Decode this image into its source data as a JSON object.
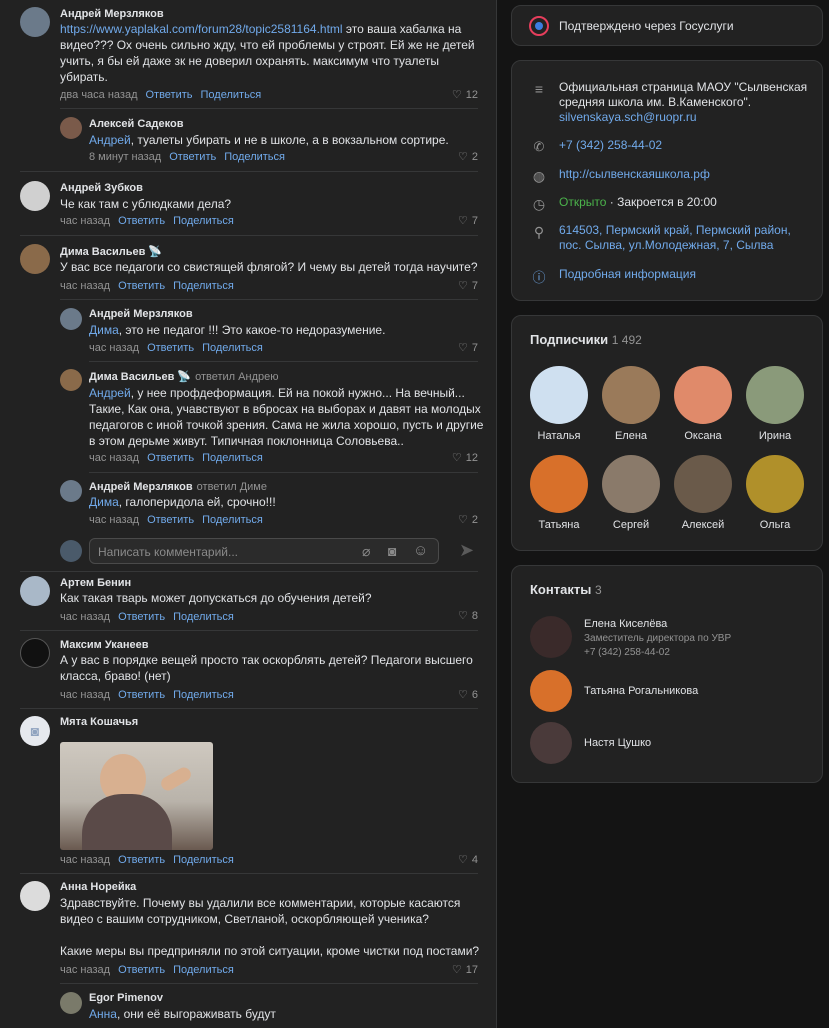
{
  "comments": [
    {
      "author": "Андрей Мерзляков",
      "link": "https://www.yaplakal.com/forum28/topic2581164.html",
      "text_after_link": " это ваша хабалка на видео??? Ох очень сильно жду, что ей проблемы у строят. Ей же не детей учить, я бы ей даже зк не доверил охранять. максимум что туалеты убирать.",
      "time": "два часа назад",
      "likes": "12"
    },
    {
      "author": "Алексей Садеков",
      "mention": "Андрей",
      "text": ", туалеты убирать и не в школе, а в вокзальном сортире.",
      "time": "8 минут назад",
      "likes": "2"
    },
    {
      "author": "Андрей Зубков",
      "text": "Че как там с ублюдками дела?",
      "time": "час назад",
      "likes": "7"
    },
    {
      "author": "Дима Васильев",
      "text": "У вас все педагоги со свистящей флягой? И чему вы детей тогда научите?",
      "time": "час назад",
      "likes": "7"
    },
    {
      "author": "Андрей Мерзляков",
      "mention": "Дима",
      "text": ", это не педагог !!! Это какое-то недоразумение.",
      "time": "час назад",
      "likes": "7"
    },
    {
      "author": "Дима Васильев",
      "replied": "ответил Андрею",
      "mention": "Андрей",
      "text": ", у нее профдеформация. Ей на покой нужно... На вечный... Такие, Как она, учавствуют в вбросах на выборах и давят на молодых педагогов с иной точкой зрения. Сама не жила хорошо, пусть и другие в этом дерьме живут. Типичная поклонница Соловьева..",
      "time": "час назад",
      "likes": "12"
    },
    {
      "author": "Андрей Мерзляков",
      "replied": "ответил Диме",
      "mention": "Дима",
      "text": ", галоперидола ей, срочно!!!",
      "time": "час назад",
      "likes": "2"
    },
    {
      "author": "Артем Бенин",
      "text": "Как такая тварь может допускаться до обучения детей?",
      "time": "час назад",
      "likes": "8"
    },
    {
      "author": "Максим Уканеев",
      "text": "А у вас в порядке вещей просто так оскорблять детей? Педагоги высшего класса, браво! (нет)",
      "time": "час назад",
      "likes": "6"
    },
    {
      "author": "Мята Кошачья",
      "text": "",
      "time": "час назад",
      "likes": "4"
    },
    {
      "author": "Анна Норейка",
      "text": "Здравствуйте. Почему вы удалили все комментарии, которые касаются видео с вашим сотрудником, Светланой, оскорбляющей ученика?",
      "text2": "Какие меры вы предприняли по этой ситуации, кроме чистки под постами?",
      "time": "час назад",
      "likes": "17"
    },
    {
      "author": "Egor Pimenov",
      "mention": "Анна",
      "text": ", они её выгораживать будут",
      "time": "",
      "likes": ""
    }
  ],
  "actions": {
    "reply": "Ответить",
    "share": "Поделиться"
  },
  "compose": {
    "placeholder": "Написать комментарий..."
  },
  "gosuslugi": "Подтверждено через Госуслуги",
  "info": {
    "description": "Официальная страница МАОУ \"Сылвенская средняя школа им. В.Каменского\".",
    "email": "silvenskaya.sch@ruopr.ru",
    "phone": "+7 (342) 258-44-02",
    "site": "http://сылвенскаяшкола.рф",
    "open": "Открыто",
    "closes": " · Закроется в 20:00",
    "address": "614503, Пермский край, Пермский район, пос. Сылва, ул.Молодежная, 7, Сылва",
    "more": "Подробная информация"
  },
  "subscribers": {
    "title": "Подписчики",
    "count": "1 492",
    "names": [
      "Наталья",
      "Елена",
      "Оксана",
      "Ирина",
      "Татьяна",
      "Сергей",
      "Алексей",
      "Ольга"
    ]
  },
  "contacts": {
    "title": "Контакты",
    "count": "3",
    "items": [
      {
        "name": "Елена Киселёва",
        "role": "Заместитель директора по УВР",
        "phone": "+7 (342) 258-44-02"
      },
      {
        "name": "Татьяна Рогальникова"
      },
      {
        "name": "Настя Цушко"
      }
    ]
  },
  "colors": {
    "accent": "#71aaeb",
    "open": "#4bb34b",
    "bg": "#222222",
    "page": "#141414"
  }
}
